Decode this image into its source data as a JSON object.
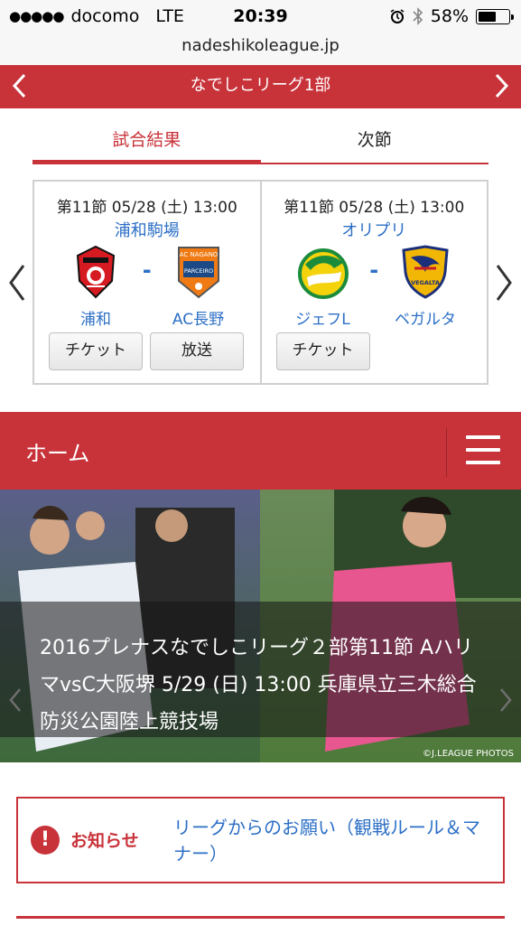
{
  "status_bar": {
    "carrier": "docomo",
    "network": "LTE",
    "time": "20:39",
    "battery": "58%"
  },
  "browser": {
    "url": "nadeshikoleague.jp"
  },
  "league_nav": {
    "title": "なでしこリーグ1部"
  },
  "tabs": [
    {
      "label": "試合結果",
      "active": true
    },
    {
      "label": "次節",
      "active": false
    }
  ],
  "matches": [
    {
      "datetime": "第11節 05/28 (土) 13:00",
      "venue": "浦和駒場",
      "home": {
        "name": "浦和",
        "emblem": "urawa-reds-emblem"
      },
      "separator": "-",
      "away": {
        "name": "AC長野",
        "emblem": "ac-nagano-parceiro-emblem",
        "emblem_text_top": "AC NAGANO",
        "emblem_text_mid": "PARCEIRO"
      },
      "buttons": [
        "チケット",
        "放送"
      ]
    },
    {
      "datetime": "第11節 05/28 (土) 13:00",
      "venue": "オリプリ",
      "home": {
        "name": "ジェフL",
        "emblem": "jef-united-emblem"
      },
      "separator": "-",
      "away": {
        "name": "ベガルタ",
        "emblem": "vegalta-sendai-emblem",
        "emblem_text": "VEGALTA"
      },
      "buttons": [
        "チケット"
      ]
    }
  ],
  "home_header": {
    "title": "ホーム"
  },
  "hero": {
    "caption": "2016プレナスなでしこリーグ２部第11節 AハリマvsC大阪堺 5/29 (日) 13:00 兵庫県立三木総合防災公園陸上競技場",
    "credit": "©J.LEAGUE PHOTOS"
  },
  "notice": {
    "icon_glyph": "!",
    "label": "お知らせ",
    "link": "リーグからのお願い（観戦ルール＆マナー）"
  },
  "colors": {
    "brand_red": "#c8333a",
    "link_blue": "#2c6fc6"
  }
}
